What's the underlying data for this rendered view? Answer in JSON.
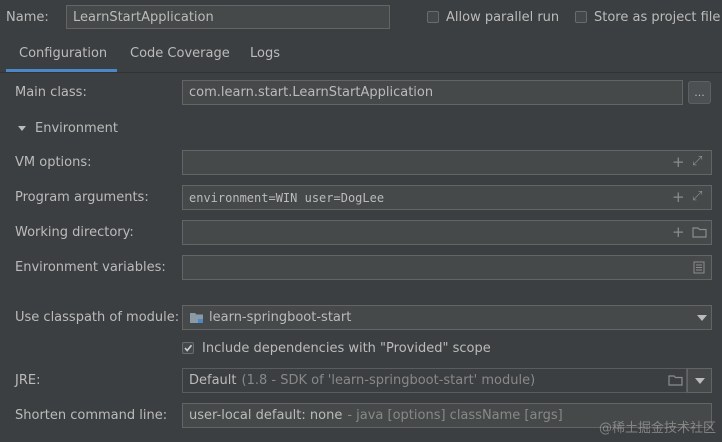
{
  "header": {
    "name_label": "Name:",
    "name_value": "LearnStartApplication",
    "allow_parallel_label": "Allow parallel run",
    "store_as_file_label": "Store as project file"
  },
  "tabs": [
    {
      "label": "Configuration",
      "active": true
    },
    {
      "label": "Code Coverage",
      "active": false
    },
    {
      "label": "Logs",
      "active": false
    }
  ],
  "form": {
    "main_class_label": "Main class:",
    "main_class_value": "com.learn.start.LearnStartApplication",
    "browse_label": "...",
    "environment_section": "Environment",
    "vm_options_label": "VM options:",
    "vm_options_value": "",
    "program_args_label": "Program arguments:",
    "program_args_value": "environment=WIN user=DogLee",
    "working_dir_label": "Working directory:",
    "working_dir_value": "",
    "env_vars_label": "Environment variables:",
    "env_vars_value": "",
    "classpath_label": "Use classpath of module:",
    "classpath_value": "learn-springboot-start",
    "include_deps_label": "Include dependencies with \"Provided\" scope",
    "include_deps_checked": true,
    "jre_label": "JRE:",
    "jre_value_main": "Default",
    "jre_value_detail": "(1.8 - SDK of 'learn-springboot-start' module)",
    "shorten_label": "Shorten command line:",
    "shorten_value_main": "user-local default: none",
    "shorten_value_detail": "- java [options] className [args]"
  },
  "watermark": "@稀土掘金技术社区",
  "colors": {
    "background": "#3c3f41",
    "field_bg": "#45494a",
    "accent_tab": "#4a88c7",
    "text": "#bbbbbb"
  }
}
